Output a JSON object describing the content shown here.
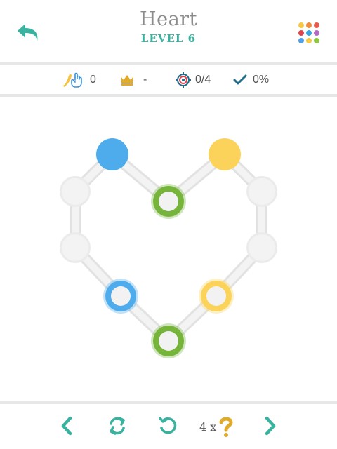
{
  "header": {
    "title": "Heart",
    "level": "LEVEL 6"
  },
  "stats": {
    "moves": "0",
    "best": "-",
    "targets": "0/4",
    "completion": "0%"
  },
  "footer": {
    "hint_count": "4 x"
  },
  "colors": {
    "teal": "#39b3a0",
    "blue": "#4eacec",
    "yellow": "#fcd35a",
    "green": "#76b43c",
    "node_empty": "#ededed",
    "pipe": "#eeeeee",
    "gold": "#e0aa2a",
    "dark_blue": "#1f6d8a"
  },
  "icons": {
    "back": "back-arrow-icon",
    "menu": "color-dots-grid-icon",
    "moves": "tap-hand-icon",
    "best": "crown-icon",
    "targets": "target-icon",
    "completion": "checkmark-icon",
    "prev": "chevron-left-icon",
    "shuffle": "shuffle-icon",
    "undo": "undo-icon",
    "hint": "question-mark-icon",
    "next": "chevron-right-icon"
  },
  "menu_dot_colors": [
    "#f7c844",
    "#f08a3c",
    "#ea5a4c",
    "#e0454d",
    "#3aa6e0",
    "#b669c5",
    "#4fa0e6",
    "#f7c844",
    "#8cc63f"
  ],
  "puzzle": {
    "nodes": [
      {
        "id": "top-left",
        "type": "dot",
        "color": "blue"
      },
      {
        "id": "top-right",
        "type": "dot",
        "color": "yellow"
      },
      {
        "id": "center-top",
        "type": "ring",
        "color": "green"
      },
      {
        "id": "left-upper",
        "type": "empty"
      },
      {
        "id": "right-upper",
        "type": "empty"
      },
      {
        "id": "left-lower",
        "type": "empty"
      },
      {
        "id": "right-lower",
        "type": "empty"
      },
      {
        "id": "bottom-left",
        "type": "ring",
        "color": "blue"
      },
      {
        "id": "bottom-right",
        "type": "ring",
        "color": "yellow"
      },
      {
        "id": "bottom",
        "type": "ring",
        "color": "green"
      }
    ],
    "edges": [
      [
        "top-left",
        "left-upper"
      ],
      [
        "top-left",
        "center-top"
      ],
      [
        "center-top",
        "top-right"
      ],
      [
        "top-right",
        "right-upper"
      ],
      [
        "left-upper",
        "left-lower"
      ],
      [
        "right-upper",
        "right-lower"
      ],
      [
        "left-lower",
        "bottom-left"
      ],
      [
        "right-lower",
        "bottom-right"
      ],
      [
        "bottom-left",
        "bottom"
      ],
      [
        "bottom-right",
        "bottom"
      ]
    ]
  }
}
